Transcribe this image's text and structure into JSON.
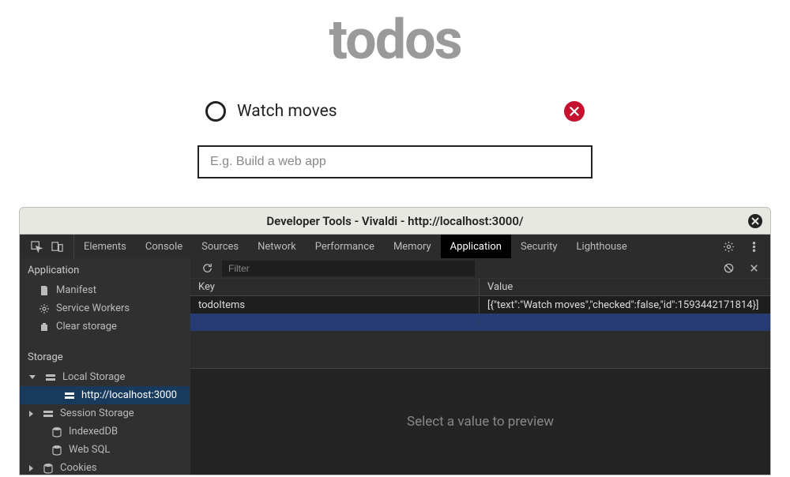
{
  "app": {
    "title": "todos",
    "items": [
      {
        "text": "Watch moves",
        "checked": false
      }
    ],
    "input_placeholder": "E.g. Build a web app"
  },
  "devtools": {
    "window_title": "Developer Tools - Vivaldi - http://localhost:3000/",
    "tabs": [
      "Elements",
      "Console",
      "Sources",
      "Network",
      "Performance",
      "Memory",
      "Application",
      "Security",
      "Lighthouse"
    ],
    "active_tab": "Application",
    "filter_placeholder": "Filter",
    "sidebar": {
      "application": {
        "title": "Application",
        "items": [
          "Manifest",
          "Service Workers",
          "Clear storage"
        ]
      },
      "storage": {
        "title": "Storage",
        "items": [
          {
            "label": "Local Storage",
            "expanded": true,
            "children": [
              "http://localhost:3000"
            ]
          },
          {
            "label": "Session Storage",
            "expanded": false
          },
          {
            "label": "IndexedDB"
          },
          {
            "label": "Web SQL"
          },
          {
            "label": "Cookies",
            "expanded": false
          }
        ]
      }
    },
    "grid": {
      "columns": [
        "Key",
        "Value"
      ],
      "rows": [
        {
          "key": "todoItems",
          "value": "[{\"text\":\"Watch moves\",\"checked\":false,\"id\":1593442171814}]"
        }
      ]
    },
    "preview_empty": "Select a value to preview"
  }
}
